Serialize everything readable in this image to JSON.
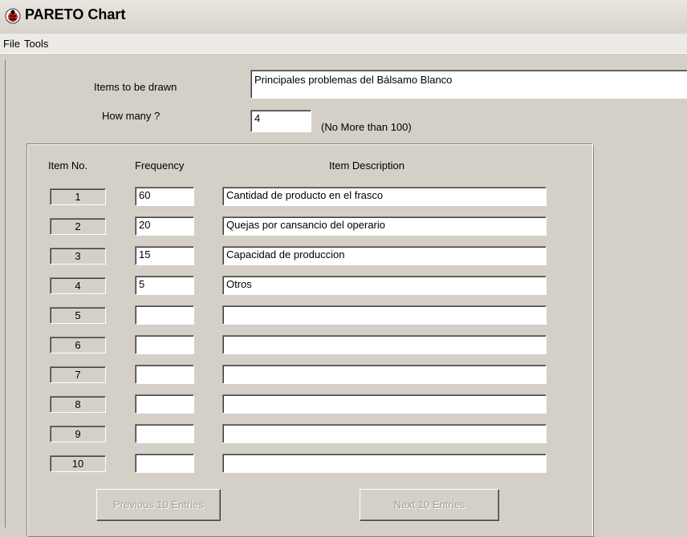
{
  "window": {
    "title": "PARETO Chart",
    "icon": "ladybug-app-icon"
  },
  "menu": {
    "items": [
      "File",
      "Tools"
    ]
  },
  "form": {
    "items_label": "Items to be drawn",
    "items_value": "Principales problemas del Bálsamo Blanco",
    "howmany_label": "How many ?",
    "howmany_value": "4",
    "howmany_hint": "(No More than 100)"
  },
  "table": {
    "headers": {
      "item_no": "Item No.",
      "frequency": "Frequency",
      "description": "Item Description"
    },
    "rows": [
      {
        "no": "1",
        "freq": "60",
        "desc": "Cantidad de producto en el frasco"
      },
      {
        "no": "2",
        "freq": "20",
        "desc": "Quejas por cansancio del operario"
      },
      {
        "no": "3",
        "freq": "15",
        "desc": "Capacidad de produccion"
      },
      {
        "no": "4",
        "freq": "5",
        "desc": "Otros"
      },
      {
        "no": "5",
        "freq": "",
        "desc": ""
      },
      {
        "no": "6",
        "freq": "",
        "desc": ""
      },
      {
        "no": "7",
        "freq": "",
        "desc": ""
      },
      {
        "no": "8",
        "freq": "",
        "desc": ""
      },
      {
        "no": "9",
        "freq": "",
        "desc": ""
      },
      {
        "no": "10",
        "freq": "",
        "desc": ""
      }
    ]
  },
  "buttons": {
    "prev": "Previous 10 Entries",
    "next": "Next 10 Entries"
  }
}
